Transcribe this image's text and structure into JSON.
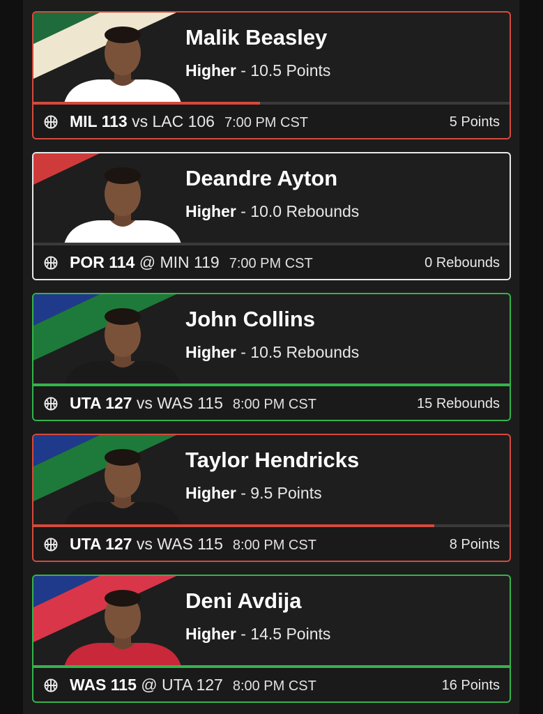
{
  "colors": {
    "loss": "#d64a3c",
    "win": "#34b44a",
    "push": "#e8e8e8"
  },
  "cards": [
    {
      "name": "Malik Beasley",
      "direction": "Higher",
      "line": "10.5 Points",
      "home_team": "MIL",
      "home_score": "113",
      "separator": "vs",
      "away": "LAC 106",
      "time": "7:00 PM CST",
      "result": "5 Points",
      "status": "loss",
      "progress": 0.476,
      "art": [
        "#1f6b3b",
        "#efe6cf"
      ],
      "jersey": "#ffffff"
    },
    {
      "name": "Deandre Ayton",
      "direction": "Higher",
      "line": "10.0 Rebounds",
      "home_team": "POR",
      "home_score": "114",
      "separator": "@",
      "away": "MIN 119",
      "time": "7:00 PM CST",
      "result": "0 Rebounds",
      "status": "push",
      "progress": 0,
      "art": [
        "#cf3b3b",
        "#1e1e1e"
      ],
      "jersey": "#ffffff"
    },
    {
      "name": "John Collins",
      "direction": "Higher",
      "line": "10.5 Rebounds",
      "home_team": "UTA",
      "home_score": "127",
      "separator": "vs",
      "away": "WAS 115",
      "time": "8:00 PM CST",
      "result": "15 Rebounds",
      "status": "win",
      "progress": 1.0,
      "art": [
        "#1f3a8a",
        "#1e7a3a"
      ],
      "jersey": "#1a1a1a"
    },
    {
      "name": "Taylor Hendricks",
      "direction": "Higher",
      "line": "9.5 Points",
      "home_team": "UTA",
      "home_score": "127",
      "separator": "vs",
      "away": "WAS 115",
      "time": "8:00 PM CST",
      "result": "8 Points",
      "status": "loss",
      "progress": 0.842,
      "art": [
        "#1f3a8a",
        "#1e7a3a"
      ],
      "jersey": "#1a1a1a"
    },
    {
      "name": "Deni Avdija",
      "direction": "Higher",
      "line": "14.5 Points",
      "home_team": "WAS",
      "home_score": "115",
      "separator": "@",
      "away": "UTA 127",
      "time": "8:00 PM CST",
      "result": "16 Points",
      "status": "win",
      "progress": 1.0,
      "art": [
        "#1f3a8a",
        "#d9364a"
      ],
      "jersey": "#c8283a"
    }
  ]
}
